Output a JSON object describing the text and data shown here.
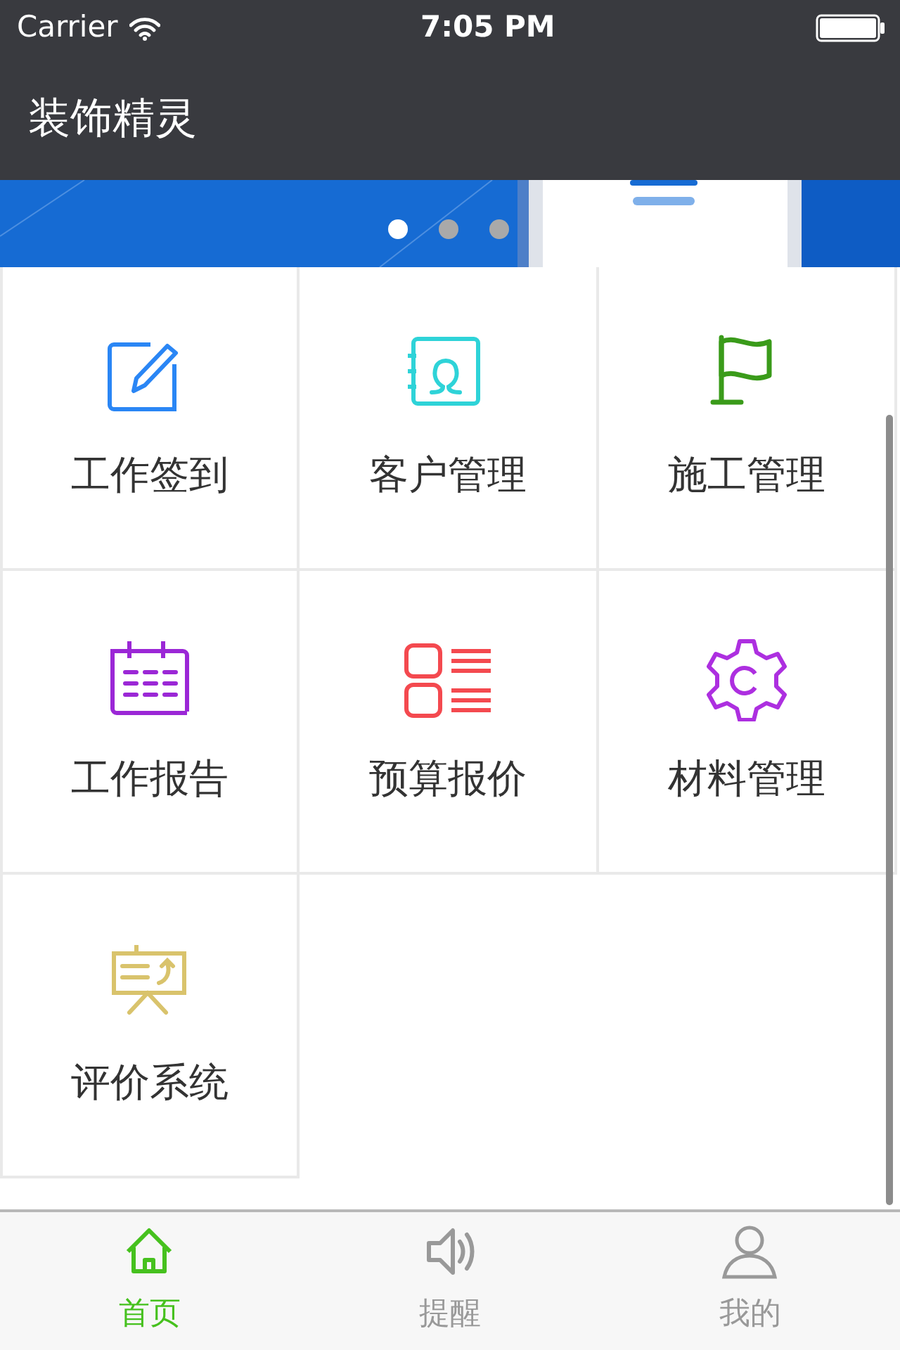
{
  "status_bar": {
    "carrier": "Carrier",
    "time": "7:05 PM"
  },
  "nav_bar": {
    "title": "装饰精灵"
  },
  "banner": {
    "kind": "picture",
    "pages": [
      {
        "selected": true
      },
      {
        "selected": false
      },
      {
        "selected": false
      }
    ]
  },
  "grid": [
    {
      "label": "工作签到",
      "kind": "edit",
      "color": "#2a86f5"
    },
    {
      "label": "客户管理",
      "kind": "contacts",
      "color": "#2ed3d8"
    },
    {
      "label": "施工管理",
      "kind": "flag",
      "color": "#3a9b1a"
    },
    {
      "label": "工作报告",
      "kind": "calendar",
      "color": "#9b27d6"
    },
    {
      "label": "预算报价",
      "kind": "list",
      "color": "#f4494f"
    },
    {
      "label": "材料管理",
      "kind": "gear",
      "color": "#ad2fe0"
    },
    {
      "label": "评价系统",
      "kind": "board",
      "color": "#d9c36c"
    }
  ],
  "tab_bar": [
    {
      "label": "首页",
      "kind": "home",
      "selected": true
    },
    {
      "label": "提醒",
      "kind": "speaker",
      "selected": false
    },
    {
      "label": "我的",
      "kind": "person",
      "selected": false
    }
  ]
}
